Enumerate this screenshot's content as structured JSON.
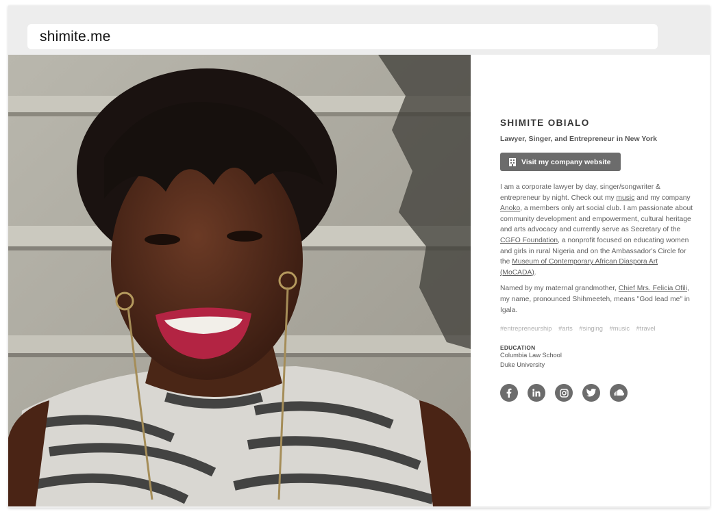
{
  "browser": {
    "url": "shimite.me"
  },
  "profile": {
    "name": "SHIMITE OBIALO",
    "tagline": "Lawyer, Singer, and Entrepreneur in New York",
    "button": {
      "label": "Visit my company website",
      "icon": "building-icon"
    },
    "bio1": {
      "t1": "I am a corporate lawyer by day, singer/songwriter & entrepreneur by night. Check out my ",
      "link1": "music",
      "t2": " and my company ",
      "link2": "Anoko",
      "t3": ", a members only art social club. I am passionate about community development and empowerment, cultural heritage and arts advocacy and currently serve as Secretary of the ",
      "link3": "CGFO Foundation",
      "t4": ", a nonprofit focused on educating women and girls in rural Nigeria and on the Ambassador's Circle for the ",
      "link4": "Museum of Contemporary African Diaspora Art (MoCADA)",
      "t5": "."
    },
    "bio2": {
      "t1": "Named by my maternal grandmother, ",
      "link1": "Chief Mrs. Felicia Ofili",
      "t2": ", my name, pronounced Shihmeeteh, means \"God lead me\" in Igala."
    },
    "tags": [
      "#entrepreneurship",
      "#arts",
      "#singing",
      "#music",
      "#travel"
    ],
    "education": {
      "heading": "EDUCATION",
      "schools": [
        "Columbia Law School",
        "Duke University"
      ]
    },
    "social": [
      "facebook-icon",
      "linkedin-icon",
      "instagram-icon",
      "twitter-icon",
      "soundcloud-icon"
    ]
  },
  "colors": {
    "button_bg": "#6c6c6c",
    "text": "#606060",
    "tags": "#b0b0b0"
  }
}
